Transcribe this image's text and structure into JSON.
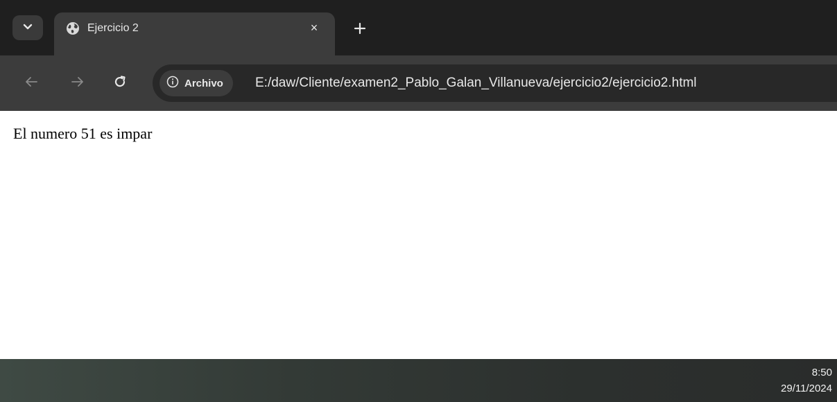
{
  "browser": {
    "tab": {
      "title": "Ejercicio 2",
      "close_glyph": "×",
      "favicon": "globe-icon"
    },
    "new_tab_glyph": "+",
    "toolbar": {
      "back": "arrow-left-icon",
      "forward": "arrow-right-icon",
      "reload": "reload-icon",
      "security_chip_label": "Archivo",
      "security_icon": "info-icon",
      "url": "E:/daw/Cliente/examen2_Pablo_Galan_Villanueva/ejercicio2/ejercicio2.html"
    },
    "colors": {
      "tabstrip": "#1f1f1f",
      "toolbar": "#3c3c3c",
      "omnibox": "#282828",
      "text": "#e8e8e8"
    }
  },
  "page": {
    "text": "El numero 51 es impar"
  },
  "taskbar": {
    "time": "8:50",
    "date": "29/11/2024"
  }
}
